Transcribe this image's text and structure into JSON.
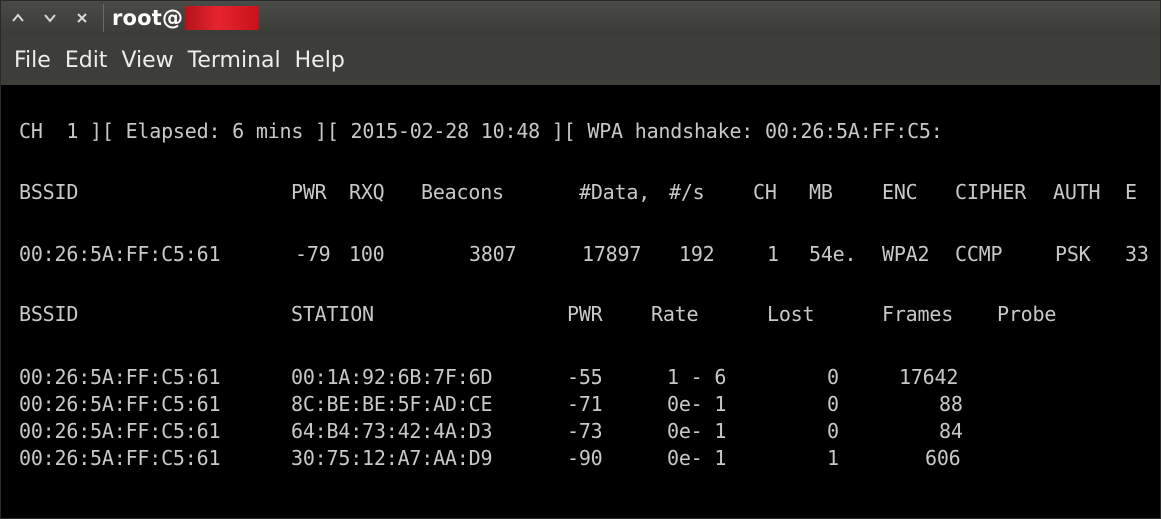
{
  "window": {
    "title": "root@",
    "buttons": [
      "^",
      "v",
      "×"
    ]
  },
  "menu": [
    "File",
    "Edit",
    "View",
    "Terminal",
    "Help"
  ],
  "status_line": "CH  1 ][ Elapsed: 6 mins ][ 2015-02-28 10:48 ][ WPA handshake: 00:26:5A:FF:C5:",
  "ap_table": {
    "headers": [
      "BSSID",
      "PWR",
      "RXQ",
      "Beacons",
      "#Data,",
      "#/s",
      "CH",
      "MB",
      "ENC",
      "CIPHER",
      "AUTH",
      "E"
    ],
    "rows": [
      [
        "00:26:5A:FF:C5:61",
        "-79",
        "100",
        "3807",
        "17897",
        "192",
        "1",
        "54e.",
        "WPA2",
        "CCMP",
        "PSK",
        "33"
      ]
    ]
  },
  "station_table": {
    "headers": [
      "BSSID",
      "STATION",
      "PWR",
      "Rate",
      "Lost",
      "Frames",
      "Probe"
    ],
    "rows": [
      [
        "00:26:5A:FF:C5:61",
        "00:1A:92:6B:7F:6D",
        "-55",
        "1 - 6",
        "0",
        "17642",
        ""
      ],
      [
        "00:26:5A:FF:C5:61",
        "8C:BE:BE:5F:AD:CE",
        "-71",
        "0e- 1",
        "0",
        "88",
        ""
      ],
      [
        "00:26:5A:FF:C5:61",
        "64:B4:73:42:4A:D3",
        "-73",
        "0e- 1",
        "0",
        "84",
        ""
      ],
      [
        "00:26:5A:FF:C5:61",
        "30:75:12:A7:AA:D9",
        "-90",
        "0e- 1",
        "1",
        "606",
        ""
      ]
    ]
  }
}
